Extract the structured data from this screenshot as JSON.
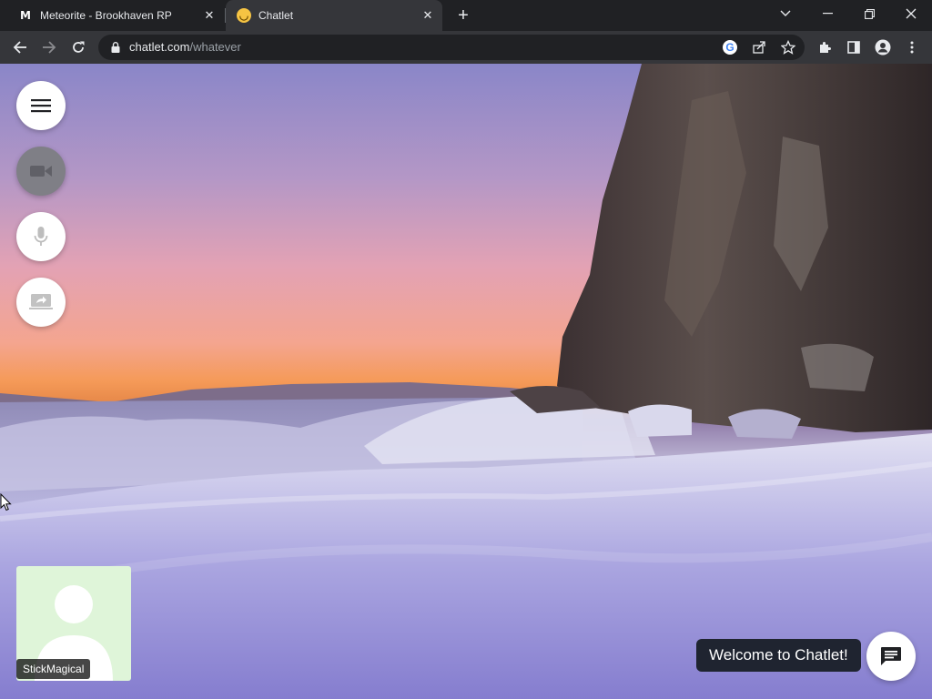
{
  "browser": {
    "tabs": [
      {
        "title": "Meteorite - Brookhaven RP",
        "favicon": "M",
        "active": false
      },
      {
        "title": "Chatlet",
        "favicon": "smiley-favicon",
        "active": true
      }
    ],
    "url_domain": "chatlet.com",
    "url_path": "/whatever"
  },
  "page": {
    "self_name": "StickMagical",
    "welcome_text": "Welcome to Chatlet!",
    "controls": {
      "menu_icon": "hamburger-icon",
      "camera_icon": "video-camera-icon",
      "mic_icon": "microphone-icon",
      "share_icon": "screen-share-icon",
      "chat_icon": "chat-icon"
    }
  },
  "colors": {
    "chrome_dark": "#202124",
    "chrome_toolbar": "#35363a",
    "tile_background": "#dff5d9",
    "welcome_bg": "#1f2430"
  }
}
